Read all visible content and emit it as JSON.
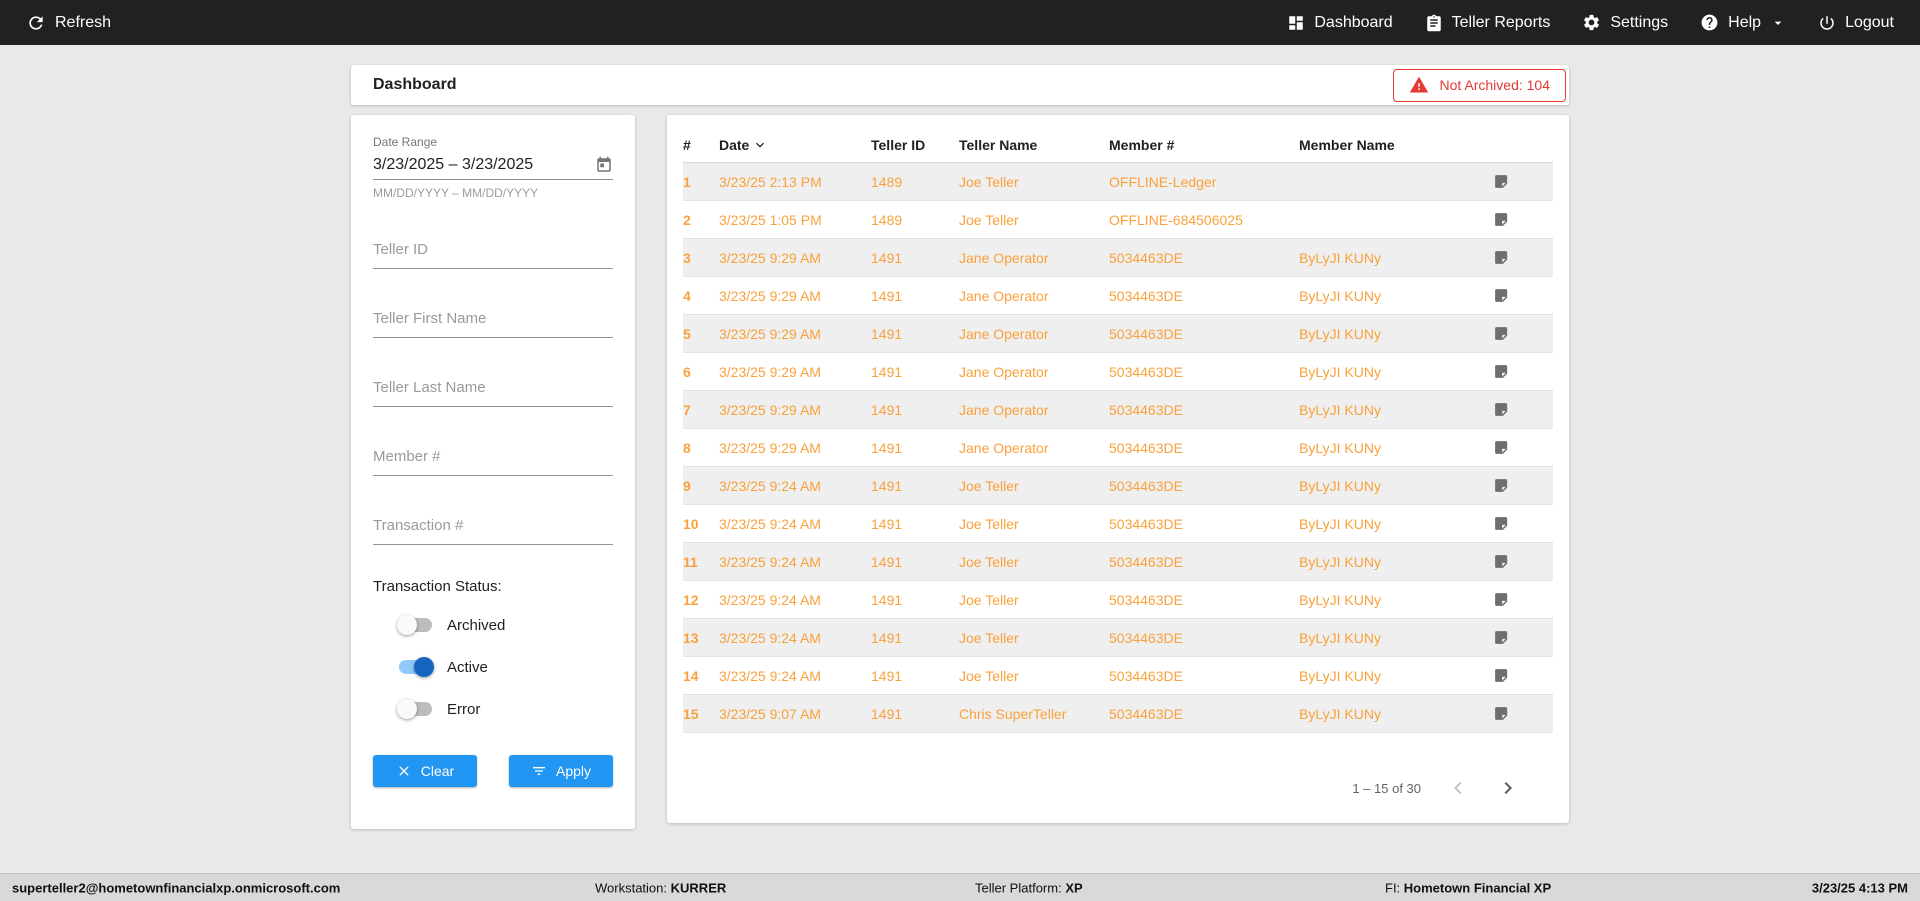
{
  "topbar": {
    "refresh_label": "Refresh",
    "nav": [
      {
        "label": "Dashboard"
      },
      {
        "label": "Teller Reports"
      },
      {
        "label": "Settings"
      },
      {
        "label": "Help"
      },
      {
        "label": "Logout"
      }
    ]
  },
  "header": {
    "title": "Dashboard",
    "not_archived": "Not Archived: 104"
  },
  "filters": {
    "date_range": {
      "label": "Date Range",
      "value": "3/23/2025 – 3/23/2025",
      "hint": "MM/DD/YYYY – MM/DD/YYYY"
    },
    "teller_id_placeholder": "Teller ID",
    "teller_first_placeholder": "Teller First Name",
    "teller_last_placeholder": "Teller Last Name",
    "member_placeholder": "Member #",
    "transaction_placeholder": "Transaction #",
    "status_label": "Transaction Status:",
    "toggles": [
      {
        "label": "Archived",
        "on": false
      },
      {
        "label": "Active",
        "on": true
      },
      {
        "label": "Error",
        "on": false
      }
    ],
    "clear_label": "Clear",
    "apply_label": "Apply"
  },
  "table": {
    "columns": [
      "#",
      "Date",
      "Teller ID",
      "Teller Name",
      "Member #",
      "Member Name"
    ],
    "rows": [
      {
        "num": "1",
        "date": "3/23/25 2:13 PM",
        "teller_id": "1489",
        "teller_name": "Joe Teller",
        "member_num": "OFFLINE-Ledger",
        "member_name": ""
      },
      {
        "num": "2",
        "date": "3/23/25 1:05 PM",
        "teller_id": "1489",
        "teller_name": "Joe Teller",
        "member_num": "OFFLINE-684506025",
        "member_name": ""
      },
      {
        "num": "3",
        "date": "3/23/25 9:29 AM",
        "teller_id": "1491",
        "teller_name": "Jane Operator",
        "member_num": "5034463DE",
        "member_name": "ByLyJI KUNy"
      },
      {
        "num": "4",
        "date": "3/23/25 9:29 AM",
        "teller_id": "1491",
        "teller_name": "Jane Operator",
        "member_num": "5034463DE",
        "member_name": "ByLyJI KUNy"
      },
      {
        "num": "5",
        "date": "3/23/25 9:29 AM",
        "teller_id": "1491",
        "teller_name": "Jane Operator",
        "member_num": "5034463DE",
        "member_name": "ByLyJI KUNy"
      },
      {
        "num": "6",
        "date": "3/23/25 9:29 AM",
        "teller_id": "1491",
        "teller_name": "Jane Operator",
        "member_num": "5034463DE",
        "member_name": "ByLyJI KUNy"
      },
      {
        "num": "7",
        "date": "3/23/25 9:29 AM",
        "teller_id": "1491",
        "teller_name": "Jane Operator",
        "member_num": "5034463DE",
        "member_name": "ByLyJI KUNy"
      },
      {
        "num": "8",
        "date": "3/23/25 9:29 AM",
        "teller_id": "1491",
        "teller_name": "Jane Operator",
        "member_num": "5034463DE",
        "member_name": "ByLyJI KUNy"
      },
      {
        "num": "9",
        "date": "3/23/25 9:24 AM",
        "teller_id": "1491",
        "teller_name": "Joe Teller",
        "member_num": "5034463DE",
        "member_name": "ByLyJI KUNy"
      },
      {
        "num": "10",
        "date": "3/23/25 9:24 AM",
        "teller_id": "1491",
        "teller_name": "Joe Teller",
        "member_num": "5034463DE",
        "member_name": "ByLyJI KUNy"
      },
      {
        "num": "11",
        "date": "3/23/25 9:24 AM",
        "teller_id": "1491",
        "teller_name": "Joe Teller",
        "member_num": "5034463DE",
        "member_name": "ByLyJI KUNy"
      },
      {
        "num": "12",
        "date": "3/23/25 9:24 AM",
        "teller_id": "1491",
        "teller_name": "Joe Teller",
        "member_num": "5034463DE",
        "member_name": "ByLyJI KUNy"
      },
      {
        "num": "13",
        "date": "3/23/25 9:24 AM",
        "teller_id": "1491",
        "teller_name": "Joe Teller",
        "member_num": "5034463DE",
        "member_name": "ByLyJI KUNy"
      },
      {
        "num": "14",
        "date": "3/23/25 9:24 AM",
        "teller_id": "1491",
        "teller_name": "Joe Teller",
        "member_num": "5034463DE",
        "member_name": "ByLyJI KUNy"
      },
      {
        "num": "15",
        "date": "3/23/25 9:07 AM",
        "teller_id": "1491",
        "teller_name": "Chris SuperTeller",
        "member_num": "5034463DE",
        "member_name": "ByLyJI KUNy"
      }
    ],
    "pagination": "1 – 15 of 30"
  },
  "statusbar": {
    "user": "superteller2@hometownfinancialxp.onmicrosoft.com",
    "workstation_label": "Workstation:",
    "workstation": "KURRER",
    "platform_label": "Teller Platform:",
    "platform": "XP",
    "fi_label": "FI:",
    "fi": "Hometown Financial XP",
    "datetime": "3/23/25 4:13 PM"
  },
  "colors": {
    "accent_orange": "#F9A13B",
    "alert_red": "#E53935",
    "primary_blue": "#2196F3",
    "topbar_bg": "#212121"
  }
}
